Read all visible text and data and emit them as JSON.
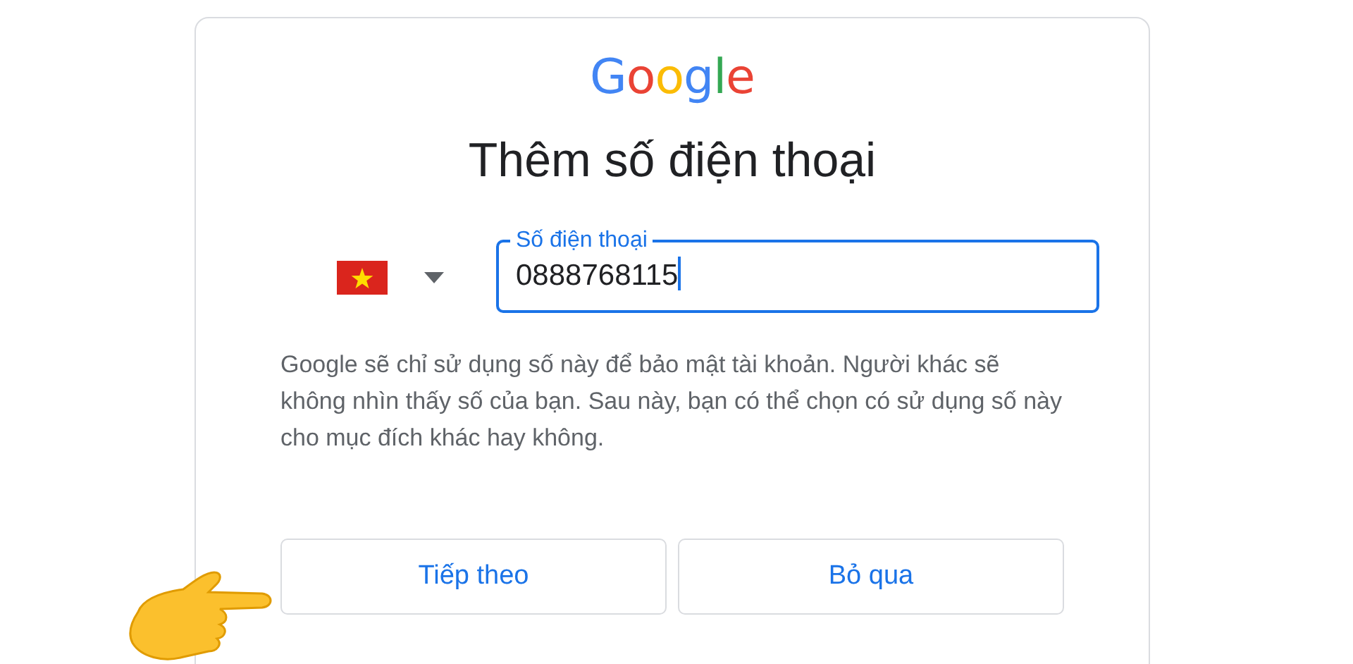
{
  "logo": "Google",
  "title": "Thêm số điện thoại",
  "phone_field": {
    "label": "Số điện thoại",
    "value": "0888768115",
    "focused": true
  },
  "help_text": "Google sẽ chỉ sử dụng số này để bảo mật tài khoản. Người khác sẽ không nhìn thấy số của bạn. Sau này, bạn có thể chọn có sử dụng số này cho mục đích khác hay không.",
  "buttons": [
    "Tiếp theo",
    "Bỏ qua"
  ]
}
